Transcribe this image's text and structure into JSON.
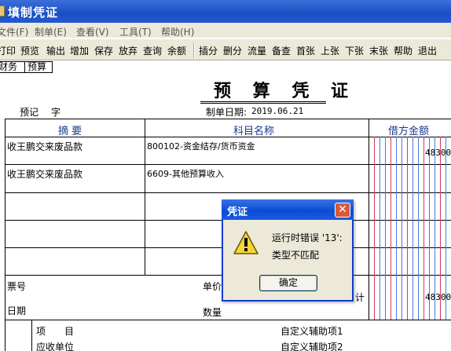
{
  "window": {
    "title": "填制凭证"
  },
  "menu": [
    "文件(F)",
    "制单(E)",
    "查看(V)",
    "工具(T)",
    "帮助(H)"
  ],
  "toolbar": [
    "打印",
    "预览",
    "输出",
    "增加",
    "保存",
    "放弃",
    "查询",
    "余额",
    "插分",
    "删分",
    "流量",
    "备查",
    "首张",
    "上张",
    "下张",
    "末张",
    "帮助",
    "退出"
  ],
  "tabs": [
    "财务",
    "预算"
  ],
  "voucher": {
    "title": "预 算 凭 证",
    "word_label": "预记",
    "zi": "字",
    "date_label": "制单日期:",
    "date": "2019.06.21",
    "headers": {
      "summary": "摘 要",
      "account": "科目名称",
      "debit": "借方金额"
    },
    "rows": [
      {
        "summary": "收王鹏交来废品款",
        "account": "800102-资金结存/货币资金",
        "amount": "48300"
      },
      {
        "summary": "收王鹏交来废品款",
        "account": "6609-其他预算收入",
        "amount": ""
      }
    ],
    "bill_no_label": "票号",
    "date2_label": "日期",
    "unit_price_label": "单价",
    "qty_label": "数量",
    "total_label": "计",
    "total_amount": "48300",
    "item_label": "项　　目",
    "receivable_label": "应收单位",
    "custom1": "自定义辅助项1",
    "custom2": "自定义辅助项2"
  },
  "dialog": {
    "title": "凭证",
    "message_line1": "运行时错误 '13':",
    "message_line2": "类型不匹配",
    "ok_label": "确定"
  }
}
